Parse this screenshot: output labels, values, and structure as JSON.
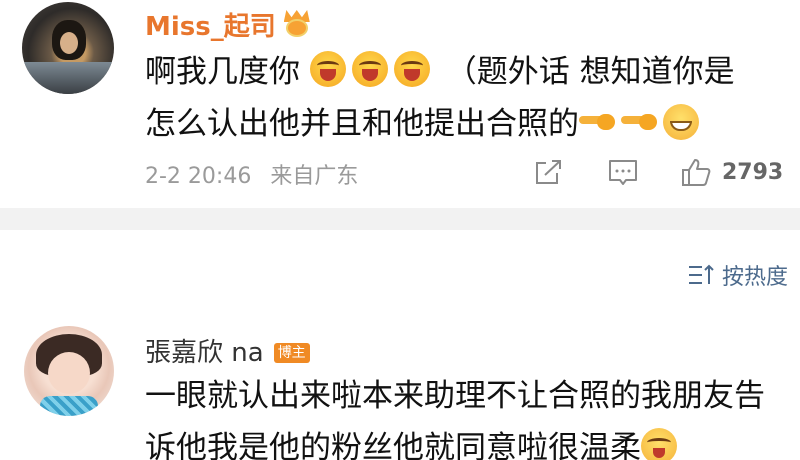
{
  "top_comment": {
    "username": "Miss_起司",
    "icons": {
      "avatar": "avatar-photo",
      "vip": "crown-badge-icon"
    },
    "text_segments": [
      "啊我几度你",
      "（题外话 想知道你是",
      "怎么认出他并且和他提出合照的"
    ],
    "emoji_names": [
      "crying-face-icon",
      "crying-face-icon",
      "crying-face-icon",
      "pointing-hand-icon",
      "pointing-hand-icon",
      "grinning-face-icon"
    ],
    "date": "2-2 20:46",
    "source": "来自广东",
    "like_count": "2793"
  },
  "sort": {
    "label": "按热度",
    "icon": "sort-icon"
  },
  "reply": {
    "author": "張嘉欣 na",
    "badge": "博主",
    "text_line1": "一眼就认出来啦本来助理不让合照的我朋友告",
    "text_line2": "诉他我是他的粉丝他就同意啦很温柔",
    "emoji_name": "touched-face-icon"
  },
  "colors": {
    "username": "#e8762d",
    "sort": "#4c6a8c",
    "badge": "#f08a24",
    "divider": "#f2f2f2"
  }
}
